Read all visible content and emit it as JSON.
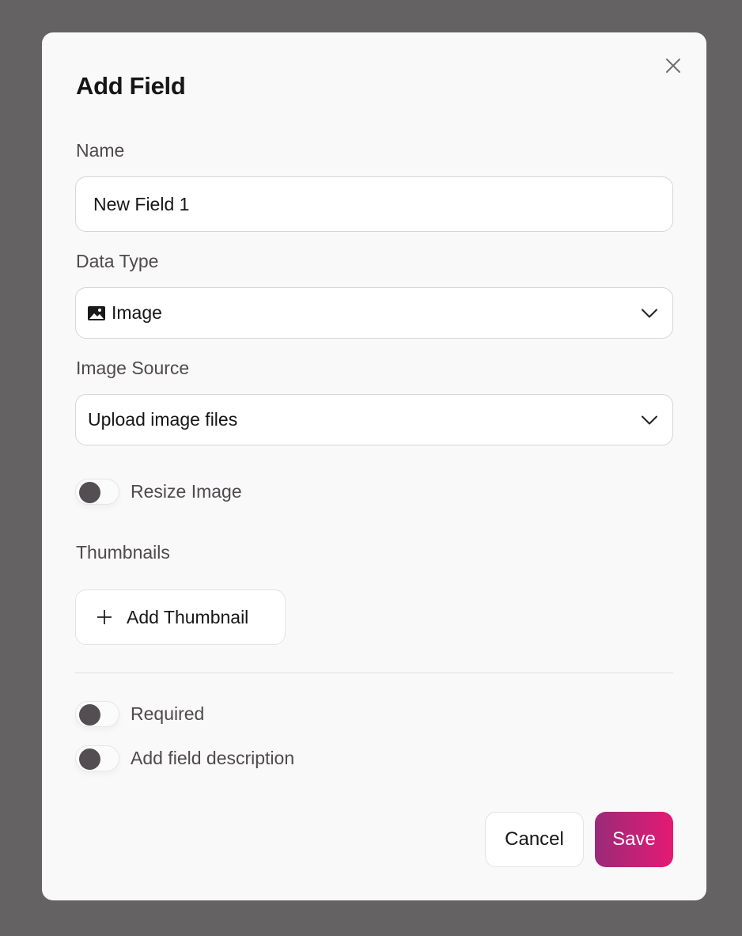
{
  "dialog": {
    "title": "Add Field",
    "close_icon": "close-icon"
  },
  "name_field": {
    "label": "Name",
    "value": "New Field 1"
  },
  "data_type": {
    "label": "Data Type",
    "selected": "Image",
    "selected_icon": "image-icon",
    "dropdown_icon": "chevron-down-icon"
  },
  "image_source": {
    "label": "Image Source",
    "selected": "Upload image files",
    "dropdown_icon": "chevron-down-icon"
  },
  "resize_image": {
    "label": "Resize Image",
    "enabled": false
  },
  "thumbnails": {
    "label": "Thumbnails",
    "add_button_label": "Add Thumbnail",
    "add_button_icon": "plus-icon"
  },
  "required": {
    "label": "Required",
    "enabled": false
  },
  "field_description": {
    "label": "Add field description",
    "enabled": false
  },
  "footer": {
    "cancel_label": "Cancel",
    "save_label": "Save"
  },
  "colors": {
    "overlay": "#646262",
    "dialog_bg": "#f9f9f9",
    "save_gradient_start": "#9a2a78",
    "save_gradient_end": "#e41a74",
    "toggle_knob": "#544d52"
  }
}
